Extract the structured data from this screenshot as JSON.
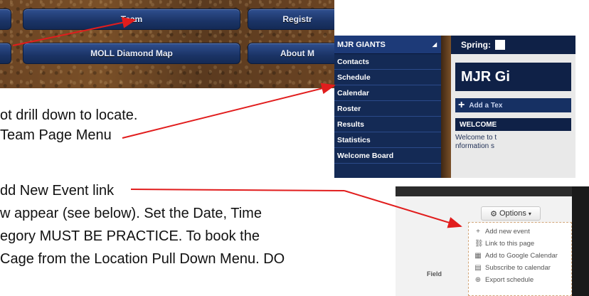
{
  "nav": {
    "buttons_row1": [
      "Team",
      "Registr"
    ],
    "buttons_row2": [
      "MOLL Diamond Map",
      "About M"
    ]
  },
  "team_menu": {
    "header": "MJR GIANTS",
    "items": [
      "Contacts",
      "Schedule",
      "Calendar",
      "Roster",
      "Results",
      "Statistics",
      "Welcome Board"
    ],
    "season_label": "Spring:",
    "team_title": "MJR Gi",
    "add_text": "Add a Tex",
    "welcome_header": "WELCOME",
    "welcome_text_1": "Welcome to t",
    "welcome_text_2": "nformation s"
  },
  "options": {
    "button_label": "Options",
    "items": [
      {
        "icon": "plus-icon",
        "glyph": "+",
        "label": "Add new event"
      },
      {
        "icon": "link-icon",
        "glyph": "⛓",
        "label": "Link to this page"
      },
      {
        "icon": "calendar-icon",
        "glyph": "▦",
        "label": "Add to Google Calendar"
      },
      {
        "icon": "subscribe-icon",
        "glyph": "▤",
        "label": "Subscribe to calendar"
      },
      {
        "icon": "export-icon",
        "glyph": "⊕",
        "label": "Export schedule"
      }
    ],
    "table_header": "Field"
  },
  "document": {
    "line1": "ot drill down to locate.",
    "line2": "Team Page Menu",
    "line3": "dd New Event link",
    "line4": "w appear (see below). Set the Date, Time",
    "line5": "egory MUST BE PRACTICE. To book the",
    "line6": "Cage from the Location Pull Down Menu. DO"
  },
  "colors": {
    "arrow": "#e11d1d",
    "nav_button": "#1b3466",
    "menu_bg": "#142a55"
  }
}
